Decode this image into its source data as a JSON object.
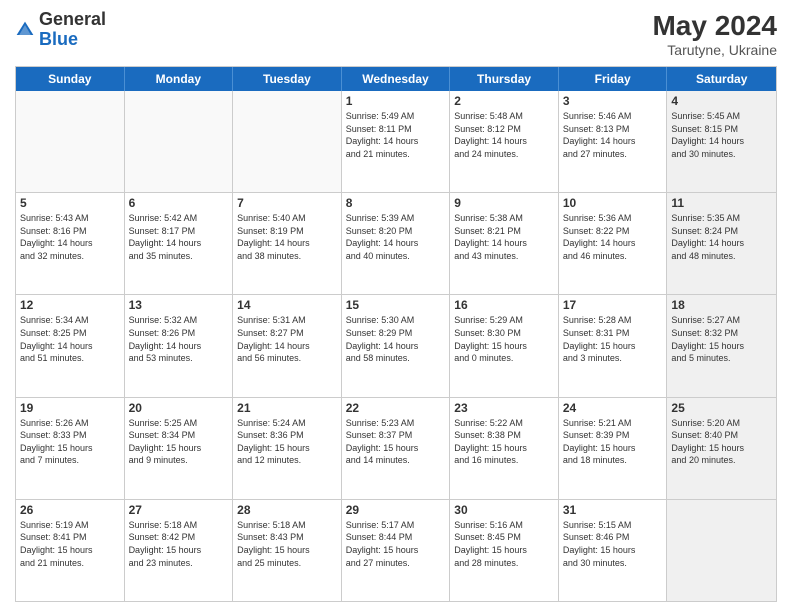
{
  "header": {
    "logo_general": "General",
    "logo_blue": "Blue",
    "month_year": "May 2024",
    "location": "Tarutyne, Ukraine"
  },
  "days_of_week": [
    "Sunday",
    "Monday",
    "Tuesday",
    "Wednesday",
    "Thursday",
    "Friday",
    "Saturday"
  ],
  "weeks": [
    [
      {
        "day": "",
        "text": "",
        "empty": true
      },
      {
        "day": "",
        "text": "",
        "empty": true
      },
      {
        "day": "",
        "text": "",
        "empty": true
      },
      {
        "day": "1",
        "text": "Sunrise: 5:49 AM\nSunset: 8:11 PM\nDaylight: 14 hours\nand 21 minutes."
      },
      {
        "day": "2",
        "text": "Sunrise: 5:48 AM\nSunset: 8:12 PM\nDaylight: 14 hours\nand 24 minutes."
      },
      {
        "day": "3",
        "text": "Sunrise: 5:46 AM\nSunset: 8:13 PM\nDaylight: 14 hours\nand 27 minutes."
      },
      {
        "day": "4",
        "text": "Sunrise: 5:45 AM\nSunset: 8:15 PM\nDaylight: 14 hours\nand 30 minutes.",
        "shaded": true
      }
    ],
    [
      {
        "day": "5",
        "text": "Sunrise: 5:43 AM\nSunset: 8:16 PM\nDaylight: 14 hours\nand 32 minutes."
      },
      {
        "day": "6",
        "text": "Sunrise: 5:42 AM\nSunset: 8:17 PM\nDaylight: 14 hours\nand 35 minutes."
      },
      {
        "day": "7",
        "text": "Sunrise: 5:40 AM\nSunset: 8:19 PM\nDaylight: 14 hours\nand 38 minutes."
      },
      {
        "day": "8",
        "text": "Sunrise: 5:39 AM\nSunset: 8:20 PM\nDaylight: 14 hours\nand 40 minutes."
      },
      {
        "day": "9",
        "text": "Sunrise: 5:38 AM\nSunset: 8:21 PM\nDaylight: 14 hours\nand 43 minutes."
      },
      {
        "day": "10",
        "text": "Sunrise: 5:36 AM\nSunset: 8:22 PM\nDaylight: 14 hours\nand 46 minutes."
      },
      {
        "day": "11",
        "text": "Sunrise: 5:35 AM\nSunset: 8:24 PM\nDaylight: 14 hours\nand 48 minutes.",
        "shaded": true
      }
    ],
    [
      {
        "day": "12",
        "text": "Sunrise: 5:34 AM\nSunset: 8:25 PM\nDaylight: 14 hours\nand 51 minutes."
      },
      {
        "day": "13",
        "text": "Sunrise: 5:32 AM\nSunset: 8:26 PM\nDaylight: 14 hours\nand 53 minutes."
      },
      {
        "day": "14",
        "text": "Sunrise: 5:31 AM\nSunset: 8:27 PM\nDaylight: 14 hours\nand 56 minutes."
      },
      {
        "day": "15",
        "text": "Sunrise: 5:30 AM\nSunset: 8:29 PM\nDaylight: 14 hours\nand 58 minutes."
      },
      {
        "day": "16",
        "text": "Sunrise: 5:29 AM\nSunset: 8:30 PM\nDaylight: 15 hours\nand 0 minutes."
      },
      {
        "day": "17",
        "text": "Sunrise: 5:28 AM\nSunset: 8:31 PM\nDaylight: 15 hours\nand 3 minutes."
      },
      {
        "day": "18",
        "text": "Sunrise: 5:27 AM\nSunset: 8:32 PM\nDaylight: 15 hours\nand 5 minutes.",
        "shaded": true
      }
    ],
    [
      {
        "day": "19",
        "text": "Sunrise: 5:26 AM\nSunset: 8:33 PM\nDaylight: 15 hours\nand 7 minutes."
      },
      {
        "day": "20",
        "text": "Sunrise: 5:25 AM\nSunset: 8:34 PM\nDaylight: 15 hours\nand 9 minutes."
      },
      {
        "day": "21",
        "text": "Sunrise: 5:24 AM\nSunset: 8:36 PM\nDaylight: 15 hours\nand 12 minutes."
      },
      {
        "day": "22",
        "text": "Sunrise: 5:23 AM\nSunset: 8:37 PM\nDaylight: 15 hours\nand 14 minutes."
      },
      {
        "day": "23",
        "text": "Sunrise: 5:22 AM\nSunset: 8:38 PM\nDaylight: 15 hours\nand 16 minutes."
      },
      {
        "day": "24",
        "text": "Sunrise: 5:21 AM\nSunset: 8:39 PM\nDaylight: 15 hours\nand 18 minutes."
      },
      {
        "day": "25",
        "text": "Sunrise: 5:20 AM\nSunset: 8:40 PM\nDaylight: 15 hours\nand 20 minutes.",
        "shaded": true
      }
    ],
    [
      {
        "day": "26",
        "text": "Sunrise: 5:19 AM\nSunset: 8:41 PM\nDaylight: 15 hours\nand 21 minutes."
      },
      {
        "day": "27",
        "text": "Sunrise: 5:18 AM\nSunset: 8:42 PM\nDaylight: 15 hours\nand 23 minutes."
      },
      {
        "day": "28",
        "text": "Sunrise: 5:18 AM\nSunset: 8:43 PM\nDaylight: 15 hours\nand 25 minutes."
      },
      {
        "day": "29",
        "text": "Sunrise: 5:17 AM\nSunset: 8:44 PM\nDaylight: 15 hours\nand 27 minutes."
      },
      {
        "day": "30",
        "text": "Sunrise: 5:16 AM\nSunset: 8:45 PM\nDaylight: 15 hours\nand 28 minutes."
      },
      {
        "day": "31",
        "text": "Sunrise: 5:15 AM\nSunset: 8:46 PM\nDaylight: 15 hours\nand 30 minutes."
      },
      {
        "day": "",
        "text": "",
        "empty": true,
        "shaded": true
      }
    ]
  ]
}
